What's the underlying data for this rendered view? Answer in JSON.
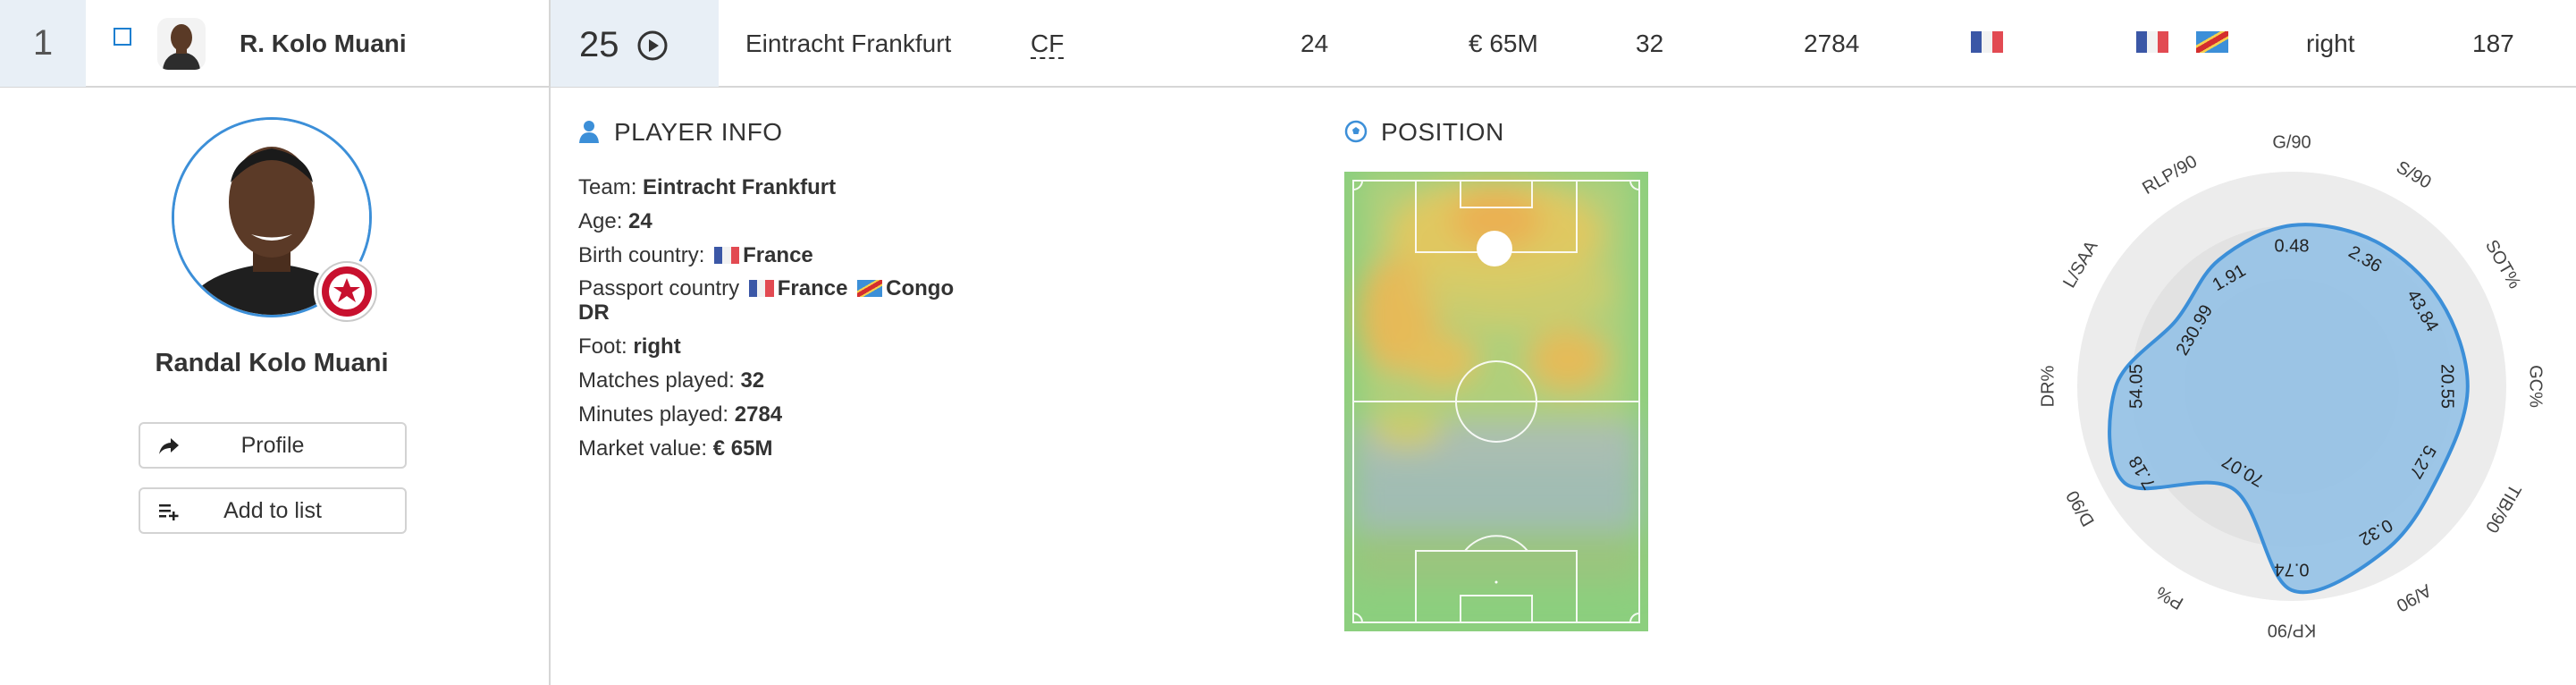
{
  "row": {
    "index": "1",
    "short_name": "R. Kolo Muani",
    "rating": "25",
    "team": "Eintracht Frankfurt",
    "position": "CF",
    "age": "24",
    "market_value": "€ 65M",
    "matches": "32",
    "minutes": "2784",
    "foot": "right",
    "height": "187"
  },
  "player": {
    "full_name": "Randal Kolo Muani",
    "profile_label": "Profile",
    "add_label": "Add to list"
  },
  "info": {
    "title": "PLAYER INFO",
    "team_label": "Team:",
    "team": "Eintracht Frankfurt",
    "age_label": "Age:",
    "age": "24",
    "birth_label": "Birth country:",
    "birth": "France",
    "passport_label": "Passport country",
    "passport1": "France",
    "passport2a": "Congo",
    "passport2b": "DR",
    "foot_label": "Foot:",
    "foot": "right",
    "matches_label": "Matches played:",
    "matches": "32",
    "minutes_label": "Minutes played:",
    "minutes": "2784",
    "market_label": "Market value:",
    "market": "€ 65M"
  },
  "position_section": {
    "title": "POSITION"
  },
  "radar": {
    "axes": [
      "G/90",
      "S/90",
      "SOT%",
      "GC%",
      "TIB/90",
      "A/90",
      "KP/90",
      "P%",
      "D/90",
      "DR%",
      "L/SAA",
      "RLP/90"
    ],
    "values": [
      "0.48",
      "2.36",
      "43.84",
      "20.55",
      "5.27",
      "0.32",
      "0.74",
      "70.07",
      "7.18",
      "54.05",
      "230.99",
      "1.91"
    ]
  },
  "colors": {
    "accent": "#3c8fd8",
    "radar_fill": "#8fbfe6",
    "pitch_green": "#8ccf7e",
    "highlight_cell": "#e8eff6"
  }
}
